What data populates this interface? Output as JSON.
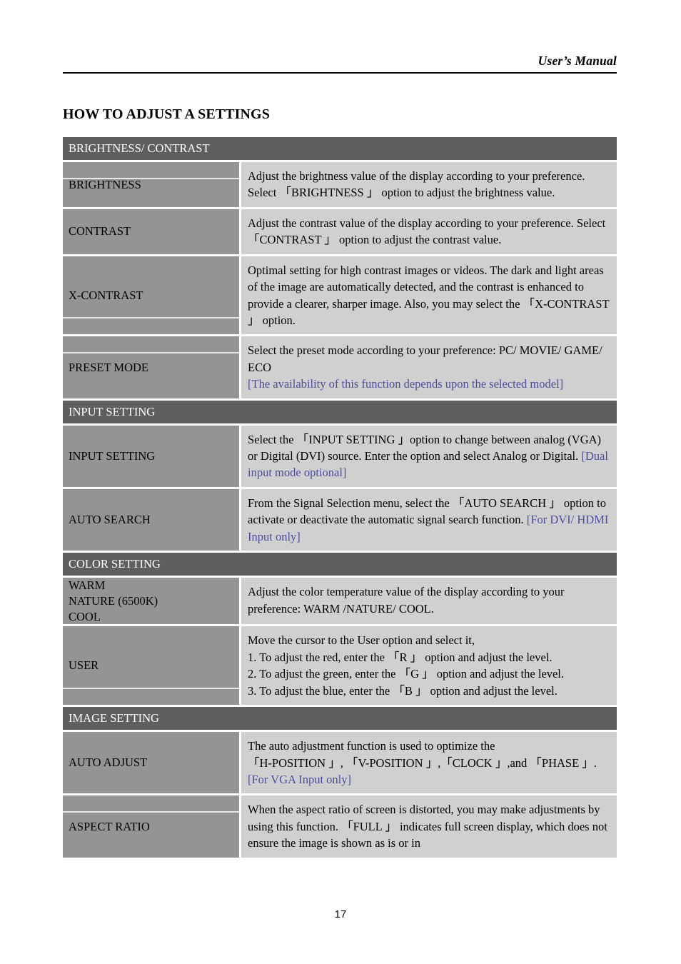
{
  "header": {
    "manual_title": "User’s Manual"
  },
  "page_title": "HOW TO ADJUST A SETTINGS",
  "page_number": "17",
  "colors": {
    "section_header_bg": "#5f5f5f",
    "label_cell_bg": "#949494",
    "desc_cell_bg": "#d0d0d0",
    "note_blue": "#4d4d9c",
    "page_bg": "#ffffff",
    "text": "#000000"
  },
  "table": {
    "sections": [
      {
        "title": "BRIGHTNESS/ CONTRAST",
        "rows": [
          {
            "label": "BRIGHTNESS",
            "divider": "top",
            "desc": "Adjust the brightness value of the display according to your preference. Select 「BRIGHTNESS 」 option to adjust the brightness value.",
            "note": ""
          },
          {
            "label": "CONTRAST",
            "divider": "none",
            "desc": "Adjust the contrast value of the display according to your preference. Select 「CONTRAST 」 option to adjust the contrast value.",
            "note": ""
          },
          {
            "label": "X-CONTRAST",
            "divider": "bottom",
            "desc": "Optimal setting for high contrast images or videos. The dark and light areas of the image are automatically detected, and the contrast is enhanced to provide a clearer, sharper image. Also, you may select the 「X-CONTRAST 」 option.",
            "note": ""
          },
          {
            "label": "PRESET MODE",
            "divider": "top",
            "desc": "Select the preset mode according to your preference: PC/ MOVIE/ GAME/ ECO",
            "note": "[The availability of this function depends upon the selected model]"
          }
        ]
      },
      {
        "title": "INPUT SETTING",
        "rows": [
          {
            "label": "INPUT SETTING",
            "divider": "none",
            "desc": "Select the 「INPUT SETTING 」option to change between analog (VGA) or Digital (DVI) source. Enter the option and select Analog or Digital.",
            "note": "[Dual input mode optional]",
            "note_inline": true
          },
          {
            "label": "AUTO SEARCH",
            "divider": "none",
            "desc": "From the Signal Selection menu, select the  「AUTO SEARCH 」 option to activate or deactivate the automatic signal search function.",
            "note": "[For DVI/ HDMI Input only]",
            "note_inline": true
          }
        ]
      },
      {
        "title": "COLOR SETTING",
        "rows": [
          {
            "label": "WARM\nNATURE (6500K)\nCOOL",
            "divider": "none",
            "desc": "Adjust the color temperature value of the display according to your preference: WARM /NATURE/ COOL.",
            "note": ""
          },
          {
            "label": "USER",
            "divider": "bottom",
            "desc_lines": [
              "Move the cursor to the User option and select it,",
              "1. To adjust the red, enter the 「R 」 option and adjust the level.",
              "2. To adjust the green, enter the 「G 」 option and adjust the level.",
              "3. To adjust the blue, enter the 「B 」 option and adjust the level."
            ],
            "note": ""
          }
        ]
      },
      {
        "title": "IMAGE SETTING",
        "rows": [
          {
            "label": "AUTO ADJUST",
            "divider": "none",
            "desc_lines": [
              "The auto adjustment function is used to optimize the",
              "「H-POSITION 」, 「V-POSITION 」,「CLOCK 」,and 「PHASE 」."
            ],
            "note": "[For VGA Input only]"
          },
          {
            "label": "ASPECT RATIO",
            "divider": "top",
            "desc": "When the aspect ratio of screen is distorted, you may make adjustments by using this function. 「FULL 」 indicates full screen display, which does not ensure the image is shown as is or in",
            "note": ""
          }
        ]
      }
    ]
  }
}
